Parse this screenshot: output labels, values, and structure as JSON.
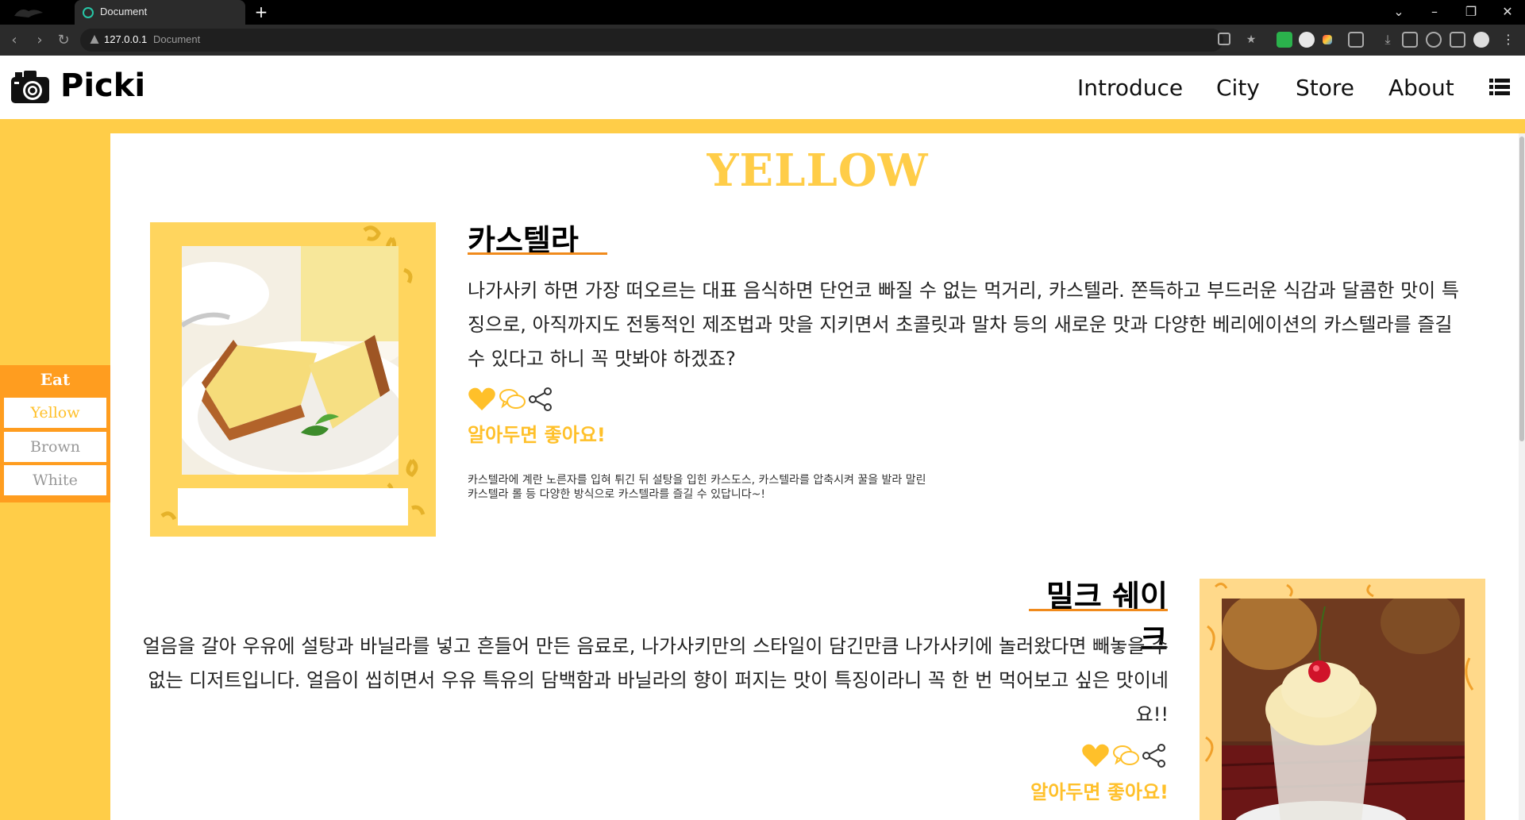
{
  "browser": {
    "tab_title": "Document",
    "new_tab": "+",
    "url_host": "127.0.0.1",
    "url_page_title": "Document"
  },
  "site": {
    "logo_text": "Picki",
    "nav": [
      "Introduce",
      "City",
      "Store",
      "About"
    ]
  },
  "sidemenu": {
    "title": "Eat",
    "items": [
      {
        "label": "Yellow",
        "color": "#ffc02a"
      },
      {
        "label": "Brown",
        "color": "#999999"
      },
      {
        "label": "White",
        "color": "#999999"
      }
    ]
  },
  "page": {
    "heading": "YELLOW"
  },
  "castella": {
    "title": "카스텔라",
    "description": "나가사키 하면 가장 떠오르는 대표 음식하면 단언코 빠질 수 없는 먹거리, 카스텔라. 쫀득하고 부드러운 식감과 달콤한 맛이 특징으로, 아직까지도 전통적인 제조법과 맛을 지키면서 초콜릿과 말차 등의 새로운 맛과 다양한 베리에이션의 카스텔라를 즐길 수 있다고 하니 꼭 맛봐야 하겠죠?",
    "tip_heading": "알아두면 좋아요!",
    "tip_text_line1": "카스텔라에 계란 노른자를 입혀 튀긴 뒤 설탕을 입힌 카스도스, 카스텔라를 압축시켜 꿀을 발라 말린",
    "tip_text_line2": "카스텔라 롤 등 다양한 방식으로 카스텔라를 즐길 수 있답니다~!"
  },
  "milkshake": {
    "title": "밀크 쉐이크",
    "description": "얼음을 갈아 우유에 설탕과 바닐라를 넣고 흔들어 만든 음료로, 나가사키만의 스타일이 담긴만큼 나가사키에 놀러왔다면 빼놓을 수 없는 디저트입니다. 얼음이 씹히면서 우유 특유의 담백함과 바닐라의 향이 퍼지는 맛이 특징이라니 꼭 한 번 먹어보고 싶은 맛이네요!!",
    "tip_heading": "알아두면 좋아요!"
  },
  "icons": [
    "heart-icon",
    "chat-icon",
    "share-icon",
    "menu-list-icon",
    "camera-icon"
  ],
  "colors": {
    "accent_yellow": "#ffcd48",
    "accent_orange": "#ff9d1f",
    "tip_yellow": "#ffc02a"
  }
}
